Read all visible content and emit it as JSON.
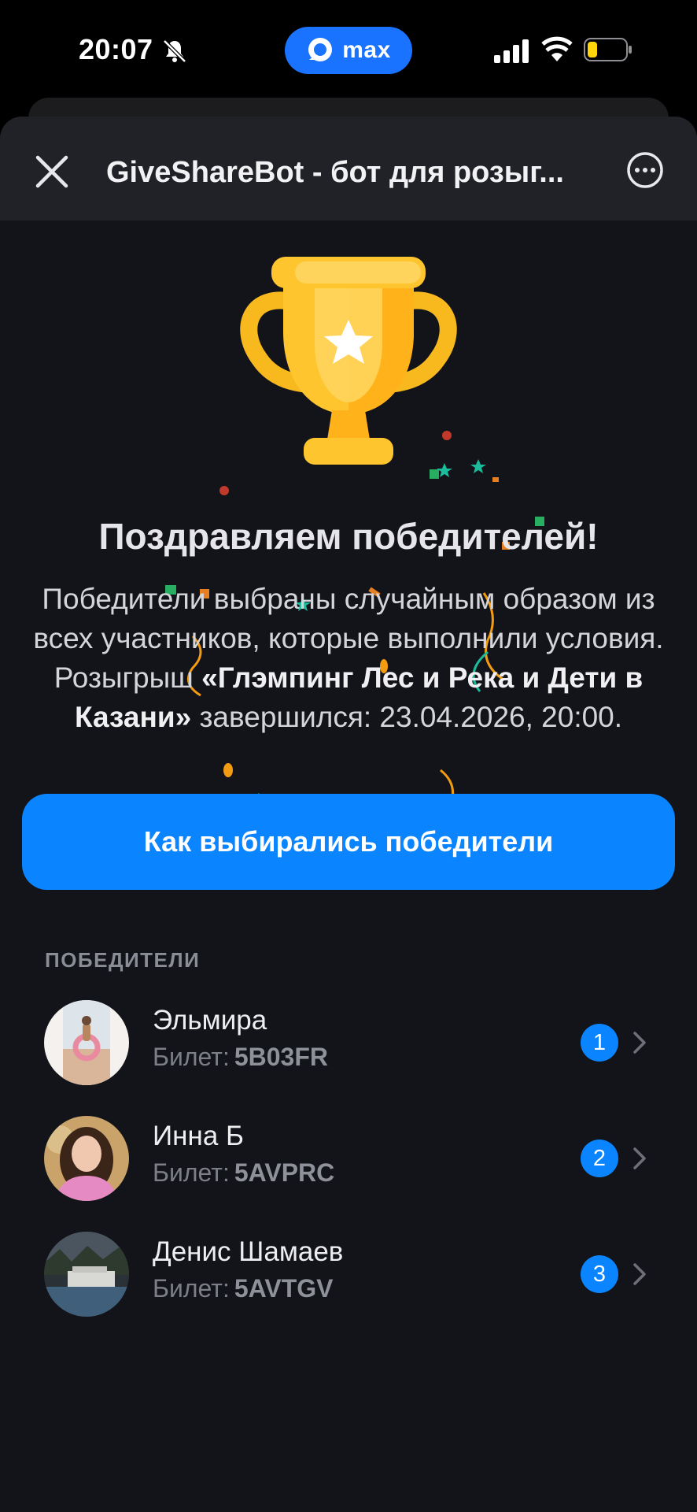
{
  "status_bar": {
    "time": "20:07",
    "app_pill_label": "max"
  },
  "header": {
    "title": "GiveShareBot - бот для розыг..."
  },
  "hero": {
    "headline": "Поздравляем победителей!",
    "desc_part1": "Победители выбраны случайным образом из всех участников, которые выполнили условия. Розыгрыш",
    "desc_bold": "«Глэмпинг Лес и Река и Дети в Казани»",
    "desc_part2": "завершился: 23.04.2026, 20:00."
  },
  "how_button": {
    "label": "Как выбирались победители"
  },
  "winners": {
    "section_label": "ПОБЕДИТЕЛИ",
    "ticket_label": "Билет:",
    "items": [
      {
        "name": "Эльмира",
        "ticket": "5B03FR",
        "rank": "1"
      },
      {
        "name": "Инна Б",
        "ticket": "5AVPRC",
        "rank": "2"
      },
      {
        "name": "Денис Шамаев",
        "ticket": "5AVTGV",
        "rank": "3"
      }
    ]
  },
  "colors": {
    "accent": "#0a84ff",
    "background": "#131419",
    "header": "#202228",
    "trophy": "#ffc52e"
  },
  "icons": [
    "bell-slash-icon",
    "max-logo-icon",
    "signal-icon",
    "wifi-icon",
    "battery-icon",
    "close-icon",
    "more-icon",
    "trophy-icon",
    "star-icon",
    "chevron-right-icon"
  ]
}
